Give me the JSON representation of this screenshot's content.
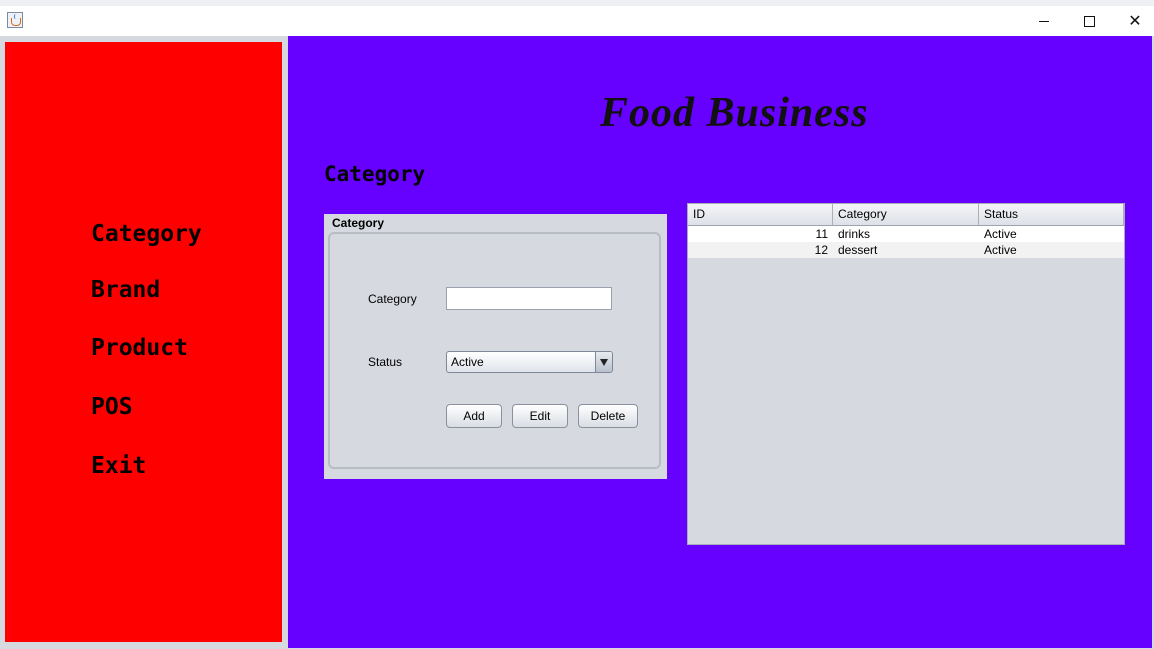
{
  "window": {
    "title": "",
    "controls": {
      "minimize": "minimize-icon",
      "maximize": "maximize-icon",
      "close": "close-icon"
    }
  },
  "sidebar": {
    "color": "#ff0000",
    "items": [
      {
        "label": "Category"
      },
      {
        "label": "Brand"
      },
      {
        "label": "Product"
      },
      {
        "label": "POS"
      },
      {
        "label": "Exit"
      }
    ]
  },
  "main": {
    "color": "#6600ff",
    "app_title": "Food Business",
    "section_title": "Category"
  },
  "form": {
    "legend": "Category",
    "category_label": "Category",
    "category_value": "",
    "status_label": "Status",
    "status_value": "Active",
    "add_label": "Add",
    "edit_label": "Edit",
    "delete_label": "Delete"
  },
  "table": {
    "columns": [
      "ID",
      "Category",
      "Status"
    ],
    "rows": [
      {
        "id": "11",
        "category": "drinks",
        "status": "Active"
      },
      {
        "id": "12",
        "category": "dessert",
        "status": "Active"
      }
    ]
  }
}
